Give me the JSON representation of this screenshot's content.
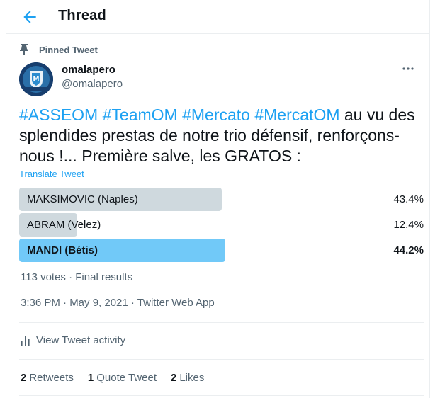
{
  "header": {
    "title": "Thread",
    "back_icon": "arrow-left-icon"
  },
  "pinned": {
    "icon": "pin-icon",
    "label": "Pinned Tweet"
  },
  "author": {
    "display_name": "omalapero",
    "handle": "@omalapero"
  },
  "more_icon": "more-horizontal-icon",
  "tweet": {
    "hashtags": [
      "#ASSEOM",
      "#TeamOM",
      "#Mercato",
      "#MercatOM"
    ],
    "text": "au vu des splendides prestas de notre trio défensif, renforçons-nous !... Première salve, les GRATOS :",
    "translate_label": "Translate Tweet"
  },
  "poll": {
    "options": [
      {
        "label": "MAKSIMOVIC (Naples)",
        "percent_text": "43.4%",
        "percent": 43.4,
        "winner": false
      },
      {
        "label": "ABRAM (Velez)",
        "percent_text": "12.4%",
        "percent": 12.4,
        "winner": false
      },
      {
        "label": "MANDI (Bétis)",
        "percent_text": "44.2%",
        "percent": 44.2,
        "winner": true
      }
    ],
    "summary": "113 votes · Final results"
  },
  "timestamp": "3:36 PM · May 9, 2021 · Twitter Web App",
  "activity": {
    "icon": "bar-chart-icon",
    "label": "View Tweet activity"
  },
  "stats": [
    {
      "count": "2",
      "label": "Retweets"
    },
    {
      "count": "1",
      "label": "Quote Tweet"
    },
    {
      "count": "2",
      "label": "Likes"
    }
  ],
  "colors": {
    "accent": "#1da1f2",
    "poll_bar": "#cfd9de",
    "poll_winner": "#71c9f8",
    "secondary_text": "#536471"
  }
}
